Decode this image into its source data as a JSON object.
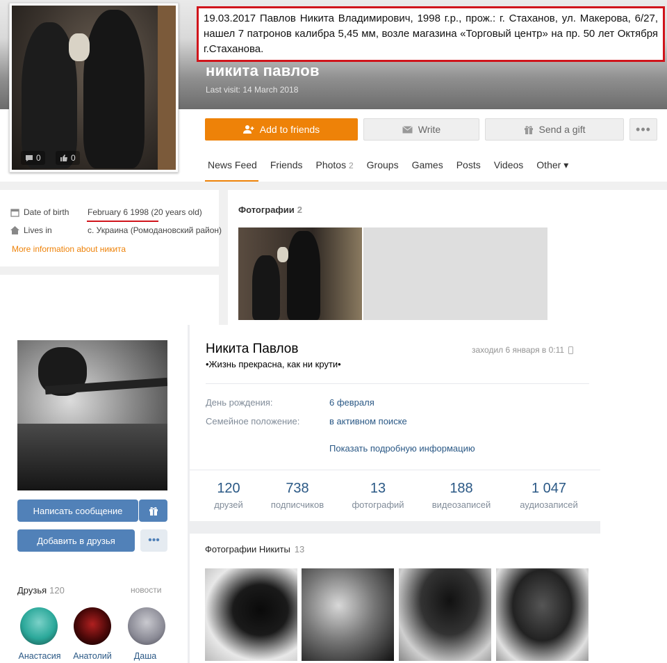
{
  "colors": {
    "accent": "#ee8208",
    "alert_border": "#d0141b",
    "vk_link": "#2a5885",
    "vk_button": "#5181b8"
  },
  "ok": {
    "news_text": "19.03.2017 Павлов Никита Владимирович, 1998 г.р., прож.: г. Стаханов, ул. Макерова, 6/27, нашел 7 патронов калибра 5,45 мм, возле магазина «Торговый центр» на пр. 50 лет Октября г.Стаханова.",
    "avatar_stats": {
      "comments": "0",
      "likes": "0"
    },
    "name": "никита павлов",
    "last_visit": "Last visit: 14 March 2018",
    "buttons": {
      "add": "Add to friends",
      "write": "Write",
      "gift": "Send a gift",
      "more": "•••"
    },
    "tabs": [
      {
        "label": "News Feed"
      },
      {
        "label": "Friends"
      },
      {
        "label": "Photos",
        "count": "2"
      },
      {
        "label": "Groups"
      },
      {
        "label": "Games"
      },
      {
        "label": "Posts"
      },
      {
        "label": "Videos"
      },
      {
        "label": "Other ▾"
      }
    ],
    "info": {
      "dob_label": "Date of birth",
      "dob_value": "February 6 1998 (20 years old)",
      "lives_label": "Lives in",
      "lives_value": "с. Украина (Ромодановский район)",
      "more": "More information about никита"
    },
    "photos": {
      "title": "Фотографии",
      "count": "2"
    }
  },
  "vk": {
    "name": "Никита Павлов",
    "status": "•Жизнь прекрасна, как ни крути•",
    "online": "заходил 6 января в 0:11",
    "rows": [
      {
        "label": "День рождения:",
        "value": "6 февраля"
      },
      {
        "label": "Семейное положение:",
        "value": "в активном поиске"
      }
    ],
    "show_more": "Показать подробную информацию",
    "counters": [
      {
        "n": "120",
        "l": "друзей"
      },
      {
        "n": "738",
        "l": "подписчиков"
      },
      {
        "n": "13",
        "l": "фотографий"
      },
      {
        "n": "188",
        "l": "видеозаписей"
      },
      {
        "n": "1 047",
        "l": "аудиозаписей"
      }
    ],
    "buttons": {
      "message": "Написать сообщение",
      "add": "Добавить в друзья",
      "more": "•••"
    },
    "friends": {
      "title": "Друзья",
      "count": "120",
      "news": "новости",
      "items": [
        {
          "name": "Анастасия"
        },
        {
          "name": "Анатолий"
        },
        {
          "name": "Даша"
        }
      ]
    },
    "photos": {
      "title": "Фотографии Никиты",
      "count": "13"
    }
  }
}
